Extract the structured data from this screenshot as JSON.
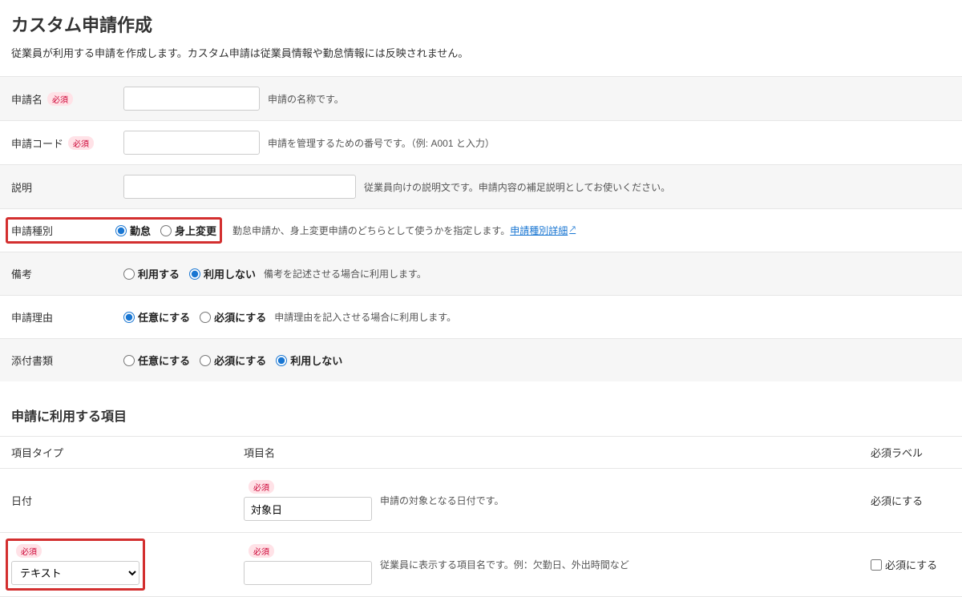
{
  "page": {
    "title": "カスタム申請作成",
    "description": "従業員が利用する申請を作成します。カスタム申請は従業員情報や勤怠情報には反映されません。"
  },
  "labels": {
    "required_badge": "必須",
    "app_name": "申請名",
    "app_name_hint": "申請の名称です。",
    "app_code": "申請コード",
    "app_code_hint": "申請を管理するための番号です。（例: A001 と入力）",
    "description": "説明",
    "description_hint": "従業員向けの説明文です。申請内容の補足説明としてお使いください。",
    "app_type": "申請種別",
    "app_type_opt1": "勤怠",
    "app_type_opt2": "身上変更",
    "app_type_hint": "勤怠申請か、身上変更申請のどちらとして使うかを指定します。",
    "app_type_link": "申請種別詳細",
    "remarks": "備考",
    "remarks_opt1": "利用する",
    "remarks_opt2": "利用しない",
    "remarks_hint": "備考を記述させる場合に利用します。",
    "reason": "申請理由",
    "reason_opt1": "任意にする",
    "reason_opt2": "必須にする",
    "reason_hint": "申請理由を記入させる場合に利用します。",
    "attachment": "添付書類",
    "attachment_opt1": "任意にする",
    "attachment_opt2": "必須にする",
    "attachment_opt3": "利用しない"
  },
  "items_section": {
    "title": "申請に利用する項目",
    "col_type": "項目タイプ",
    "col_name": "項目名",
    "col_req": "必須ラベル",
    "row1": {
      "type": "日付",
      "name_value": "対象日",
      "hint": "申請の対象となる日付です。",
      "req_label": "必須にする"
    },
    "row2": {
      "type_value": "テキスト",
      "hint": "従業員に表示する項目名です。例：欠勤日、外出時間など",
      "req_label": "必須にする"
    }
  }
}
